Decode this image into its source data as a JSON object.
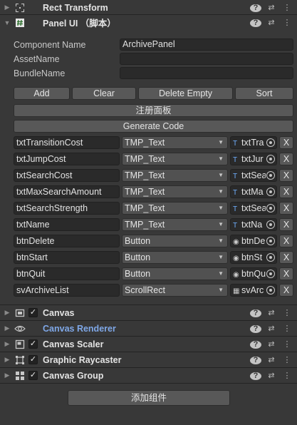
{
  "components_top": [
    {
      "title": "Rect Transform",
      "icon": "rect-transform-icon",
      "fold": "▶"
    },
    {
      "title": "Panel UI （脚本）",
      "icon": "script-hash-icon",
      "fold": "▼"
    }
  ],
  "panel": {
    "props": [
      {
        "label": "Component Name",
        "value": "ArchivePanel"
      },
      {
        "label": "AssetName",
        "value": ""
      },
      {
        "label": "BundleName",
        "value": ""
      }
    ],
    "buttons": {
      "add": "Add",
      "clear": "Clear",
      "delete_empty": "Delete Empty",
      "sort": "Sort"
    },
    "register_label": "注册面板",
    "generate_label": "Generate Code",
    "rows": [
      {
        "name": "txtTransitionCost",
        "type": "TMP_Text",
        "ref_icon": "T",
        "ref": "txtTra",
        "remove": "X"
      },
      {
        "name": "txtJumpCost",
        "type": "TMP_Text",
        "ref_icon": "T",
        "ref": "txtJur",
        "remove": "X"
      },
      {
        "name": "txtSearchCost",
        "type": "TMP_Text",
        "ref_icon": "T",
        "ref": "txtSea",
        "remove": "X"
      },
      {
        "name": "txtMaxSearchAmount",
        "type": "TMP_Text",
        "ref_icon": "T",
        "ref": "txtMa",
        "remove": "X"
      },
      {
        "name": "txtSearchStrength",
        "type": "TMP_Text",
        "ref_icon": "T",
        "ref": "txtSea",
        "remove": "X"
      },
      {
        "name": "txtName",
        "type": "TMP_Text",
        "ref_icon": "T",
        "ref": "txtNa",
        "remove": "X"
      },
      {
        "name": "btnDelete",
        "type": "Button",
        "ref_icon": "◉",
        "ref": "btnDe",
        "remove": "X"
      },
      {
        "name": "btnStart",
        "type": "Button",
        "ref_icon": "◉",
        "ref": "btnSt",
        "remove": "X"
      },
      {
        "name": "btnQuit",
        "type": "Button",
        "ref_icon": "◉",
        "ref": "btnQu",
        "remove": "X"
      },
      {
        "name": "svArchiveList",
        "type": "ScrollRect",
        "ref_icon": "▦",
        "ref": "svArc",
        "remove": "X"
      }
    ]
  },
  "components_bottom": [
    {
      "title": "Canvas",
      "icon": "canvas-icon",
      "checked": true,
      "blue": false
    },
    {
      "title": "Canvas Renderer",
      "icon": "eye-icon",
      "checked": false,
      "blue": true
    },
    {
      "title": "Canvas Scaler",
      "icon": "canvas-scaler-icon",
      "checked": true,
      "blue": false
    },
    {
      "title": "Graphic Raycaster",
      "icon": "raycaster-icon",
      "checked": true,
      "blue": false
    },
    {
      "title": "Canvas Group",
      "icon": "canvas-group-icon",
      "checked": true,
      "blue": false
    }
  ],
  "add_component_label": "添加组件",
  "colors": {
    "background": "#383838",
    "field": "#2a2a2a",
    "button": "#585858",
    "blue_title": "#7fa8e8"
  }
}
